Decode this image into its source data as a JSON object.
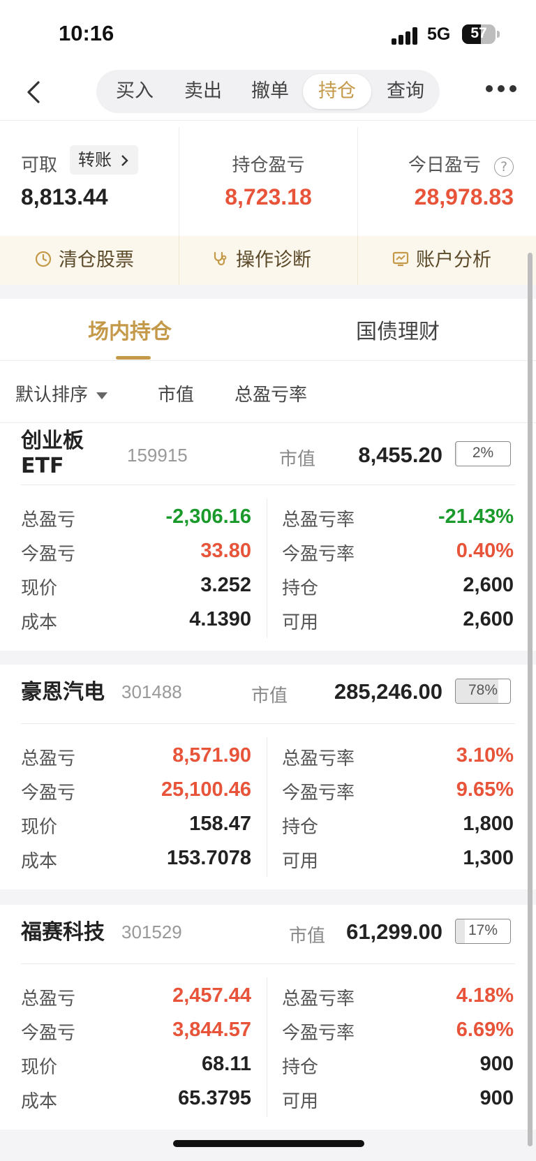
{
  "status": {
    "time": "10:16",
    "network": "5G",
    "battery": "57",
    "battery_level_percent": 57
  },
  "nav": {
    "tabs": [
      "买入",
      "卖出",
      "撤单",
      "持仓",
      "查询"
    ],
    "active_tab": "持仓"
  },
  "summary": {
    "available_label": "可取",
    "transfer_label": "转账",
    "available_value": "8,813.44",
    "position_pl_label": "持仓盈亏",
    "position_pl_value": "8,723.18",
    "today_pl_label": "今日盈亏",
    "today_pl_value": "28,978.83"
  },
  "actions": [
    "清仓股票",
    "操作诊断",
    "账户分析"
  ],
  "position_tabs": [
    "场内持仓",
    "国债理财"
  ],
  "sort": {
    "default": "默认排序",
    "market_value": "市值",
    "total_pl_rate": "总盈亏率"
  },
  "labels": {
    "market_value": "市值",
    "total_pl": "总盈亏",
    "today_pl": "今盈亏",
    "price": "现价",
    "cost": "成本",
    "total_pl_rate": "总盈亏率",
    "today_pl_rate": "今盈亏率",
    "holding": "持仓",
    "available": "可用"
  },
  "holdings": [
    {
      "name_line1": "创业板",
      "name_line2": "ETF",
      "code": "159915",
      "market_value": "8,455.20",
      "weight": "2%",
      "weight_value": 2,
      "total_pl": "-2,306.16",
      "today_pl": "33.80",
      "price": "3.252",
      "cost": "4.1390",
      "total_pl_rate": "-21.43%",
      "today_pl_rate": "0.40%",
      "holding": "2,600",
      "available": "2,600"
    },
    {
      "name_line1": "豪恩汽电",
      "name_line2": "",
      "code": "301488",
      "market_value": "285,246.00",
      "weight": "78%",
      "weight_value": 78,
      "total_pl": "8,571.90",
      "today_pl": "25,100.46",
      "price": "158.47",
      "cost": "153.7078",
      "total_pl_rate": "3.10%",
      "today_pl_rate": "9.65%",
      "holding": "1,800",
      "available": "1,300"
    },
    {
      "name_line1": "福赛科技",
      "name_line2": "",
      "code": "301529",
      "market_value": "61,299.00",
      "weight": "17%",
      "weight_value": 17,
      "total_pl": "2,457.44",
      "today_pl": "3,844.57",
      "price": "68.11",
      "cost": "65.3795",
      "total_pl_rate": "4.18%",
      "today_pl_rate": "6.69%",
      "holding": "900",
      "available": "900"
    }
  ],
  "colors": {
    "accent": "#c49a4a",
    "gain": "#e8543a",
    "loss": "#1a9a2a"
  }
}
